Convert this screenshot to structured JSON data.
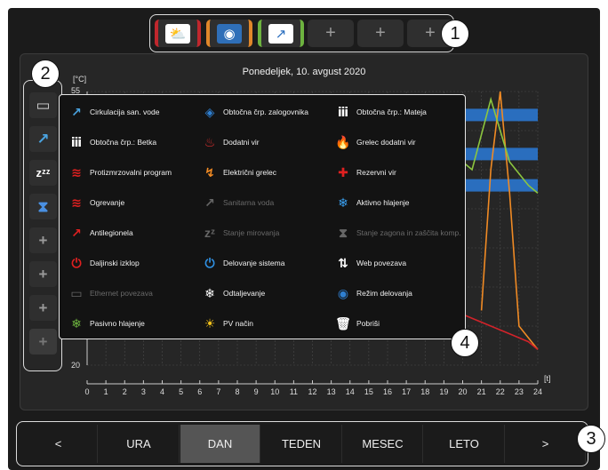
{
  "top_widgets": [
    {
      "name": "weather",
      "icon": "sun-cloud-icon",
      "symbol": "⛅",
      "frame_color": "#c0272d",
      "icon_bg": "#ffffff"
    },
    {
      "name": "storage",
      "icon": "storage-tank-icon",
      "symbol": "◉",
      "frame_color": "#e0872a",
      "icon_bg": "#2f6fb8"
    },
    {
      "name": "legionella",
      "icon": "shower-icon",
      "symbol": "↗",
      "frame_color": "#6db33f",
      "icon_bg": "#ffffff"
    },
    {
      "name": "add",
      "icon": "plus-icon",
      "symbol": "+"
    },
    {
      "name": "add",
      "icon": "plus-icon",
      "symbol": "+"
    },
    {
      "name": "add",
      "icon": "plus-icon",
      "symbol": "+"
    }
  ],
  "markers": [
    "1",
    "2",
    "3",
    "4"
  ],
  "sidebar": [
    {
      "icon": "ethernet-icon",
      "symbol": "▭"
    },
    {
      "icon": "shower-icon",
      "symbol": "↗"
    },
    {
      "icon": "sleep-icon",
      "symbol": "zᶻᶻ"
    },
    {
      "icon": "hourglass-icon",
      "symbol": "⧗"
    },
    {
      "icon": "plus-icon",
      "symbol": "+"
    },
    {
      "icon": "plus-icon",
      "symbol": "+"
    },
    {
      "icon": "plus-icon",
      "symbol": "+"
    },
    {
      "icon": "plus-icon",
      "symbol": "+"
    }
  ],
  "chart": {
    "title": "Ponedeljek, 10. avgust 2020",
    "ylabel": "[°C]",
    "xlabel": "[t]",
    "ytick_top": "55",
    "ytick_bottom": "20",
    "xticks": [
      "0",
      "1",
      "2",
      "3",
      "4",
      "5",
      "6",
      "7",
      "8",
      "9",
      "10",
      "11",
      "12",
      "13",
      "14",
      "15",
      "16",
      "17",
      "18",
      "19",
      "20",
      "21",
      "22",
      "23",
      "24"
    ]
  },
  "chart_data": {
    "type": "line",
    "title": "Ponedeljek, 10. avgust 2020",
    "xlabel": "[t]",
    "ylabel": "[°C]",
    "xlim": [
      0,
      24
    ],
    "ylim": [
      20,
      55
    ],
    "series": [
      {
        "color": "#f08a24",
        "x": [
          21.0,
          21.5,
          22.0,
          22.5,
          23.0,
          24.0
        ],
        "y": [
          27,
          45,
          55,
          42,
          25,
          22
        ]
      },
      {
        "color": "#8cc63f",
        "x": [
          19.5,
          20.5,
          21.5,
          22.0,
          22.5,
          23.5,
          24.0
        ],
        "y": [
          47,
          45,
          54,
          50,
          46,
          43,
          42
        ]
      },
      {
        "color": "#d2232a",
        "x": [
          19.5,
          20.5,
          21.5,
          22.5,
          23.5,
          24.0
        ],
        "y": [
          27,
          26,
          25,
          24,
          23,
          22
        ]
      }
    ],
    "bands": [
      {
        "color": "#2a6ebe",
        "x_range": [
          20,
          24
        ],
        "y_level": 52
      },
      {
        "color": "#2a6ebe",
        "x_range": [
          20,
          24
        ],
        "y_level": 47
      },
      {
        "color": "#2a6ebe",
        "x_range": [
          20,
          24
        ],
        "y_level": 43
      }
    ],
    "grid": true
  },
  "menu": [
    {
      "label": "Cirkulacija san. vode",
      "icon": "circulation-shower-icon",
      "symbol": "↗",
      "color": "#4aa3e0",
      "enabled": true
    },
    {
      "label": "Obtočna črp. zalogovnika",
      "icon": "storage-pump-icon",
      "symbol": "◈",
      "color": "#2f7fd0",
      "enabled": true
    },
    {
      "label": "Obtočna črp.: Mateja",
      "icon": "radiator-1-icon",
      "symbol": "ⅲ",
      "color": "#ffffff",
      "enabled": true
    },
    {
      "label": "Obtočna črp.: Betka",
      "icon": "radiator-2-icon",
      "symbol": "ⅲ",
      "color": "#ffffff",
      "enabled": true
    },
    {
      "label": "Dodatni vir",
      "icon": "extra-source-icon",
      "symbol": "♨",
      "color": "#e03030",
      "enabled": true
    },
    {
      "label": "Grelec dodatni vir",
      "icon": "flame-icon",
      "symbol": "🔥",
      "color": "#e02020",
      "enabled": true
    },
    {
      "label": "Protizmrzovalni program",
      "icon": "antifreeze-icon",
      "symbol": "≋",
      "color": "#e02020",
      "enabled": true
    },
    {
      "label": "Električni grelec",
      "icon": "electric-heater-icon",
      "symbol": "↯",
      "color": "#f08a24",
      "enabled": true
    },
    {
      "label": "Rezervni vir",
      "icon": "reserve-source-icon",
      "symbol": "✚",
      "color": "#e02020",
      "enabled": true
    },
    {
      "label": "Ogrevanje",
      "icon": "heating-icon",
      "symbol": "≋",
      "color": "#e02020",
      "enabled": true
    },
    {
      "label": "Sanitarna voda",
      "icon": "shower-icon",
      "symbol": "↗",
      "color": "#666666",
      "enabled": false
    },
    {
      "label": "Aktivno hlajenje",
      "icon": "snowflake-icon",
      "symbol": "❄",
      "color": "#3aa0f0",
      "enabled": true
    },
    {
      "label": "Antilegionela",
      "icon": "antilegionella-icon",
      "symbol": "↗",
      "color": "#e02020",
      "enabled": true
    },
    {
      "label": "Stanje mirovanja",
      "icon": "sleep-icon",
      "symbol": "zᶻ",
      "color": "#666666",
      "enabled": false
    },
    {
      "label": "Stanje zagona in zaščita komp.",
      "icon": "hourglass-icon",
      "symbol": "⧗",
      "color": "#666666",
      "enabled": false
    },
    {
      "label": "Daljinski izklop",
      "icon": "remote-off-icon",
      "symbol": "⏻",
      "color": "#e02020",
      "enabled": true
    },
    {
      "label": "Delovanje sistema",
      "icon": "power-icon",
      "symbol": "⏻",
      "color": "#2f8fe0",
      "enabled": true
    },
    {
      "label": "Web povezava",
      "icon": "up-down-arrows-icon",
      "symbol": "⇅",
      "color": "#ffffff",
      "enabled": true
    },
    {
      "label": "Ethernet povezava",
      "icon": "ethernet-icon",
      "symbol": "▭",
      "color": "#666666",
      "enabled": false
    },
    {
      "label": "Odtaljevanje",
      "icon": "defrost-icon",
      "symbol": "❄",
      "color": "#ffffff",
      "enabled": true
    },
    {
      "label": "Režim delovanja",
      "icon": "operating-mode-icon",
      "symbol": "◉",
      "color": "#2f7fd0",
      "enabled": true
    },
    {
      "label": "Pasivno hlajenje",
      "icon": "passive-cooling-icon",
      "symbol": "❄",
      "color": "#6db33f",
      "enabled": true
    },
    {
      "label": "PV način",
      "icon": "pv-sun-icon",
      "symbol": "☀",
      "color": "#f2c21b",
      "enabled": true
    },
    {
      "label": "Pobriši",
      "icon": "trash-icon",
      "symbol": "🗑",
      "color": "#ffffff",
      "enabled": true
    }
  ],
  "bottom_nav": {
    "prev": "<",
    "items": [
      "URA",
      "DAN",
      "TEDEN",
      "MESEC",
      "LETO"
    ],
    "active": "DAN",
    "next": ">"
  }
}
